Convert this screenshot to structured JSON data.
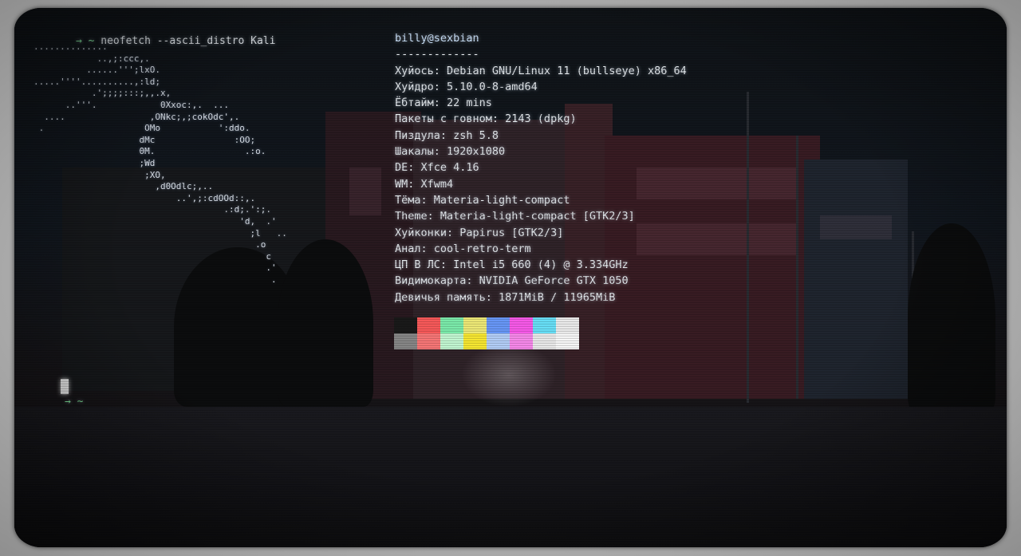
{
  "terminal": {
    "command_prompt": "→ ~",
    "command": "neofetch --ascii_distro Kali",
    "next_prompt": "→ ~"
  },
  "ascii_art": [
    "..............",
    "            ..,;:ccc,.",
    "          ......''';lxO.",
    ".....''''..........,:ld;",
    "           .';;;;:::;,,.x,",
    "      ..'''.            0Xxoc:,.  ...",
    "  ....                ,ONkc;,;cokOdc',.",
    " .                   OMo           ':ddo.",
    "                    dMc               :OO;",
    "                    0M.                 .:o.",
    "                    ;Wd",
    "                     ;XO,",
    "                       ,d0Odlc;,..",
    "                           ..',;:cdOOd::,.",
    "                                    .:d;.':;.",
    "                                       'd,  .'",
    "                                         ;l   ..",
    "                                          .o",
    "                                            c",
    "                                            .'",
    "                                             ."
  ],
  "info": {
    "userhost": "billy@sexbian",
    "separator": "-------------",
    "lines": [
      "Хуйось: Debian GNU/Linux 11 (bullseye) x86_64",
      "Хуйдро: 5.10.0-8-amd64",
      "Ёбтайм: 22 mins",
      "Пакеты с говном: 2143 (dpkg)",
      "Пиздула: zsh 5.8",
      "Шакалы: 1920x1080",
      "DE: Xfce 4.16",
      "WM: Xfwm4",
      "Тёма: Materia-light-compact",
      "Theme: Materia-light-compact [GTK2/3]",
      "Хуйконки: Papirus [GTK2/3]",
      "Анал: cool-retro-term",
      "ЦП В ЛС: Intel i5 660 (4) @ 3.334GHz",
      "Видимокарта: NVIDIA GeForce GTX 1050",
      "Девичья память: 1871MiB / 11965MiB"
    ]
  },
  "palette": {
    "row1": [
      "#1a1a1a",
      "#ff5c5c",
      "#7ff2b0",
      "#f5f07a",
      "#6b9cff",
      "#ff5cf0",
      "#6be6ff",
      "#f2f2f2"
    ],
    "row2": [
      "#8a8a8a",
      "#ff7a7a",
      "#c8ffd8",
      "#ffee33",
      "#b8d4ff",
      "#ff8cf2",
      "#f0f0f0",
      "#ffffff"
    ]
  }
}
